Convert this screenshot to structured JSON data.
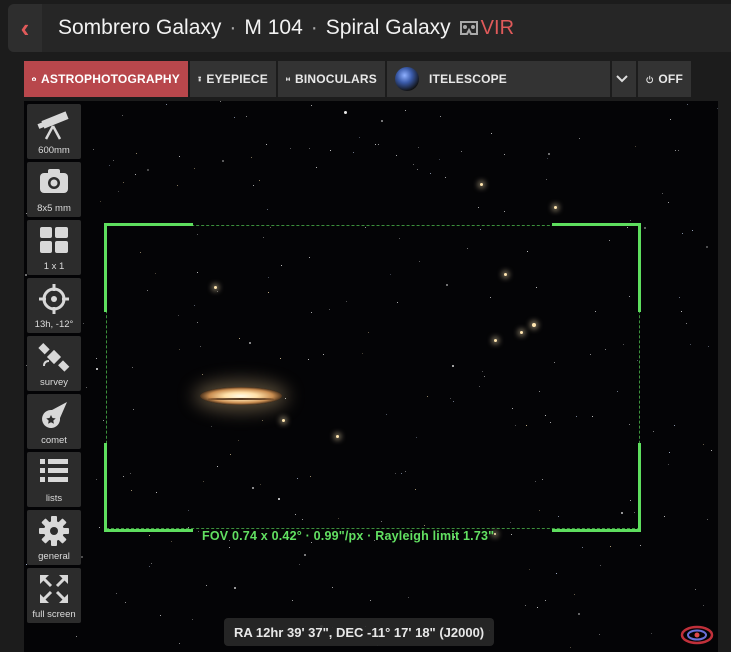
{
  "header": {
    "title_parts": [
      "Sombrero Galaxy",
      "M 104",
      "Spiral Galaxy"
    ],
    "separator": "·",
    "vir_label": "VIR"
  },
  "toolbar": {
    "astro_label": "ASTROPHOTOGRAPHY",
    "eyepiece_label": "EYEPIECE",
    "binoculars_label": "BINOCULARS",
    "telescope_label": "ITELESCOPE",
    "off_label": "OFF"
  },
  "sidebar": {
    "items": [
      {
        "label": "600mm",
        "icon": "telescope-icon"
      },
      {
        "label": "8x5 mm",
        "icon": "camera-icon"
      },
      {
        "label": "1 x 1",
        "icon": "grid-icon"
      },
      {
        "label": "13h, -12°",
        "icon": "crosshair-icon"
      },
      {
        "label": "survey",
        "icon": "satellite-icon"
      },
      {
        "label": "comet",
        "icon": "comet-icon"
      },
      {
        "label": "lists",
        "icon": "list-icon"
      },
      {
        "label": "general",
        "icon": "gear-icon"
      },
      {
        "label": "full screen",
        "icon": "fullscreen-icon"
      }
    ]
  },
  "view": {
    "fov_text": "FOV 0.74 x 0.42° · 0.99\"/px · Rayleigh limit 1.73\"",
    "coords_text": "RA 12hr 39' 37\", DEC -11° 17' 18\" (J2000)"
  },
  "colors": {
    "accent": "#b8474c",
    "fov_green": "#5ede5e",
    "back_arrow": "#e05a5a"
  }
}
